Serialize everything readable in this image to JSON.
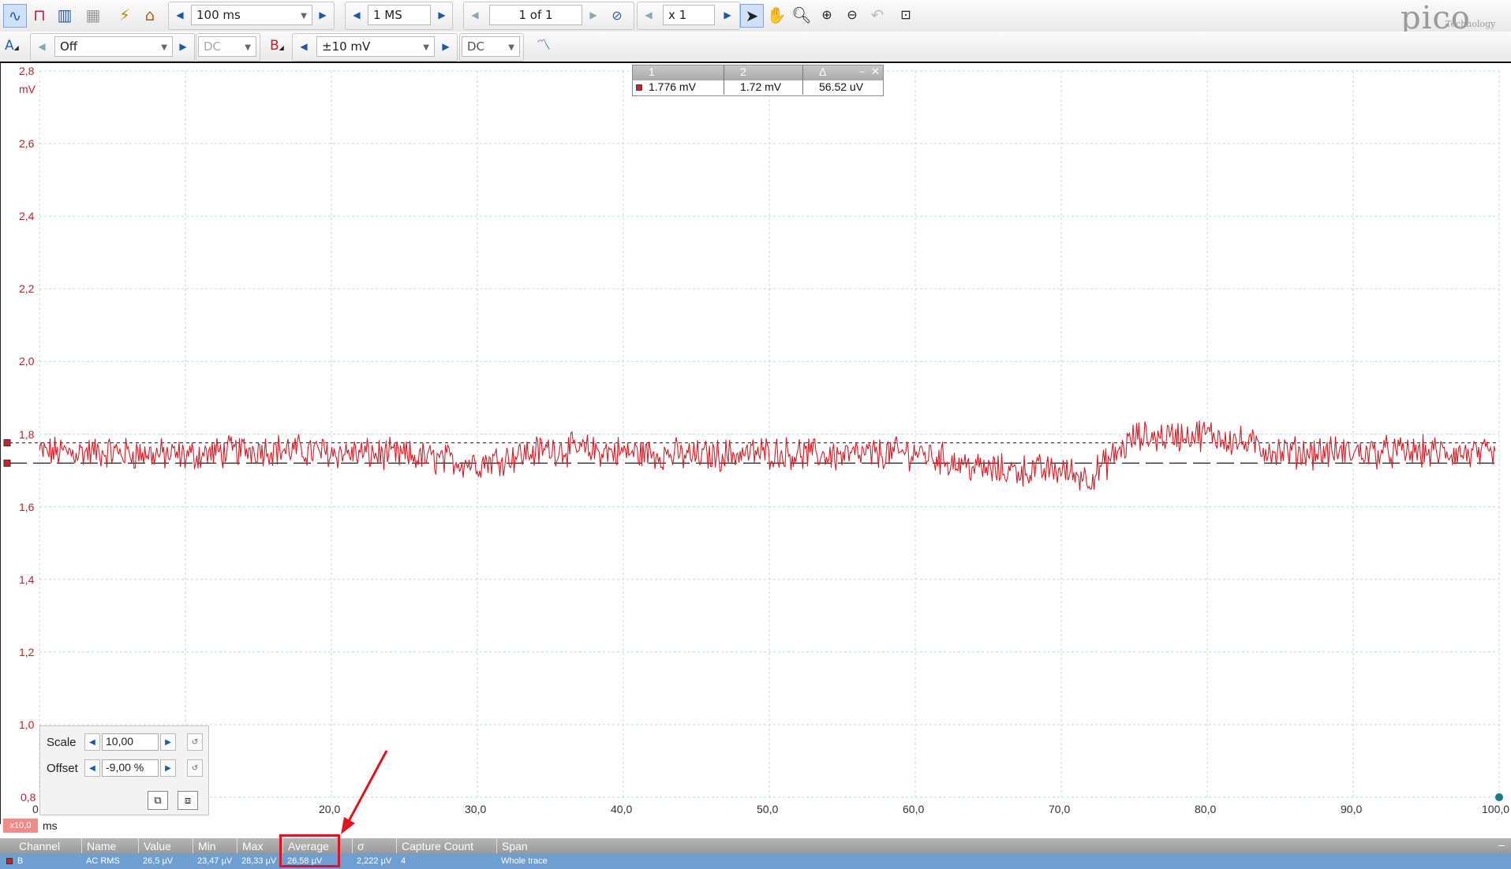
{
  "toolbar1": {
    "timebase": "100 ms",
    "samples": "1 MS",
    "buffer": "1 of 1",
    "zoom": "x 1",
    "brand": "pico",
    "brand_sub": "Technology"
  },
  "toolbar2": {
    "channel_a_label": "A",
    "channel_a_range": "Off",
    "channel_a_coupling": "DC",
    "channel_b_label": "B",
    "channel_b_range": "±10 mV",
    "channel_b_coupling": "DC"
  },
  "axes": {
    "y_unit": "mV",
    "y_ticks": [
      "2,8",
      "2,6",
      "2,4",
      "2,2",
      "2,0",
      "1,8",
      "1,6",
      "1,4",
      "1,2",
      "1,0",
      "0,8"
    ],
    "x_unit": "ms",
    "x_ticks": [
      "0",
      "20,0",
      "30,0",
      "40,0",
      "50,0",
      "60,0",
      "70,0",
      "80,0",
      "90,0",
      "100,0"
    ],
    "x_multiplier": "x10,0"
  },
  "ruler_popup": {
    "col1": "1",
    "col2": "2",
    "col3": "Δ",
    "val1": "1.776 mV",
    "val2": "1.72 mV",
    "val3": "56.52 uV"
  },
  "scale_panel": {
    "scale_label": "Scale",
    "scale_value": "10,00",
    "offset_label": "Offset",
    "offset_value": "-9,00 %"
  },
  "measurements": {
    "headers": [
      "Channel",
      "Name",
      "Value",
      "Min",
      "Max",
      "Average",
      "σ",
      "Capture Count",
      "Span"
    ],
    "row": [
      "B",
      "AC RMS",
      "26,5 µV",
      "23,47 µV",
      "28,33 µV",
      "26,58 µV",
      "2,222 µV",
      "4",
      "Whole trace"
    ]
  },
  "colors": {
    "trace": "#d0202a",
    "highlight": "#e0141e",
    "meas_row": "#6f9fd0",
    "grid": "#b8dde4"
  },
  "chart_data": {
    "type": "line",
    "xlabel": "ms",
    "ylabel": "mV",
    "xlim": [
      0,
      100
    ],
    "ylim": [
      0.8,
      2.8
    ],
    "series": [
      {
        "values_description_x": [
          0,
          5,
          10,
          15,
          20,
          25,
          30,
          35,
          40,
          45,
          50,
          55,
          60,
          65,
          70,
          72,
          75,
          80,
          85,
          90,
          95,
          100
        ],
        "values": [
          1.75,
          1.75,
          1.74,
          1.76,
          1.75,
          1.74,
          1.72,
          1.76,
          1.75,
          1.74,
          1.75,
          1.74,
          1.75,
          1.7,
          1.7,
          1.68,
          1.79,
          1.8,
          1.75,
          1.75,
          1.75,
          1.74
        ]
      }
    ],
    "ruler_levels_mV": [
      1.776,
      1.72
    ]
  }
}
